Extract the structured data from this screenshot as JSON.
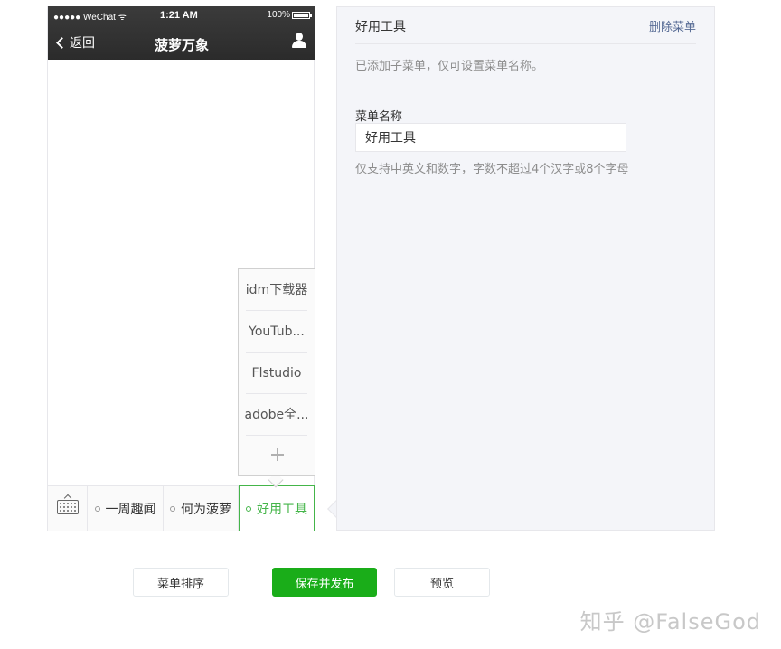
{
  "phone": {
    "status": {
      "carrier": "●●●●● WeChat ᯤ",
      "time": "1:21 AM",
      "battery": "100%"
    },
    "nav": {
      "back_label": "返回",
      "title": "菠萝万象"
    },
    "menu": {
      "items": [
        {
          "label": "一周趣闻"
        },
        {
          "label": "何为菠萝"
        },
        {
          "label": "好用工具"
        }
      ],
      "submenu": [
        {
          "label": "idm下载器"
        },
        {
          "label": "YouTub..."
        },
        {
          "label": "Flstudio"
        },
        {
          "label": "adobe全..."
        }
      ]
    }
  },
  "editor": {
    "title": "好用工具",
    "delete_label": "删除菜单",
    "tip": "已添加子菜单，仅可设置菜单名称。",
    "name_label": "菜单名称",
    "name_value": "好用工具",
    "name_hint": "仅支持中英文和数字，字数不超过4个汉字或8个字母"
  },
  "actions": {
    "sort_label": "菜单排序",
    "save_label": "保存并发布",
    "preview_label": "预览"
  },
  "watermark": "知乎 @FalseGod",
  "colors": {
    "accent_green": "#44b549",
    "save_green": "#1aad19",
    "link_blue": "#576b95",
    "panel_bg": "#f4f5f9"
  }
}
